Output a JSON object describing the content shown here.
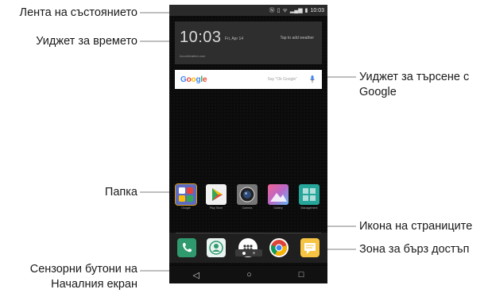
{
  "labels": {
    "status_bar": "Лента на състоянието",
    "weather_widget": "Уиджет за времето",
    "search_widget_line1": "Уиджет за търсене с",
    "search_widget_line2": "Google",
    "folder": "Папка",
    "page_icon": "Икона на страниците",
    "quick_access": "Зона за бърз достъп",
    "home_buttons_line1": "Сензорни бутони на",
    "home_buttons_line2": "Началния екран"
  },
  "phone": {
    "status_time": "10:03",
    "weather": {
      "time": "10:03",
      "date": "Fri, Apr 14",
      "tap_hint": "Tap to add weather",
      "source": "AccuWeather.com"
    },
    "search": {
      "logo": "Google",
      "hint": "Say \"Ok Google\""
    },
    "apps": [
      {
        "name": "Google",
        "icon": "folder-icon"
      },
      {
        "name": "Play Store",
        "icon": "play-store-icon"
      },
      {
        "name": "Camera",
        "icon": "camera-icon"
      },
      {
        "name": "Gallery",
        "icon": "gallery-icon"
      },
      {
        "name": "Management",
        "icon": "management-icon"
      }
    ],
    "dock": [
      "phone-icon",
      "contacts-icon",
      "apps-icon",
      "chrome-icon",
      "messages-icon"
    ],
    "nav": {
      "back": "◁",
      "home": "○",
      "recents": "□"
    }
  },
  "colors": {
    "phone_bg": "#0b0b0b",
    "dock_phone": "#2f9a6d",
    "dock_messages": "#f6c343"
  }
}
